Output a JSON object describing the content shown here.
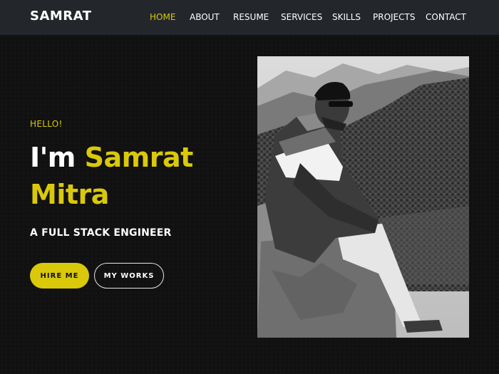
{
  "brand": "SAMRAT",
  "nav": {
    "items": [
      {
        "label": "HOME",
        "active": true
      },
      {
        "label": "ABOUT",
        "active": false
      },
      {
        "label": "RESUME",
        "active": false
      },
      {
        "label": "SERVICES",
        "active": false
      },
      {
        "label": "SKILLS",
        "active": false
      },
      {
        "label": "PROJECTS",
        "active": false
      },
      {
        "label": "CONTACT",
        "active": false
      }
    ]
  },
  "hero": {
    "greeting": "HELLO!",
    "headline_prefix": "I'm",
    "headline_name_first": "Samrat",
    "headline_name_last": "Mitra",
    "subtitle": "A FULL STACK ENGINEER",
    "hire_button": "HIRE ME",
    "works_button": "MY WORKS"
  },
  "colors": {
    "accent": "#d9c90a",
    "navbar_bg": "#23272b",
    "page_bg": "#111111"
  }
}
